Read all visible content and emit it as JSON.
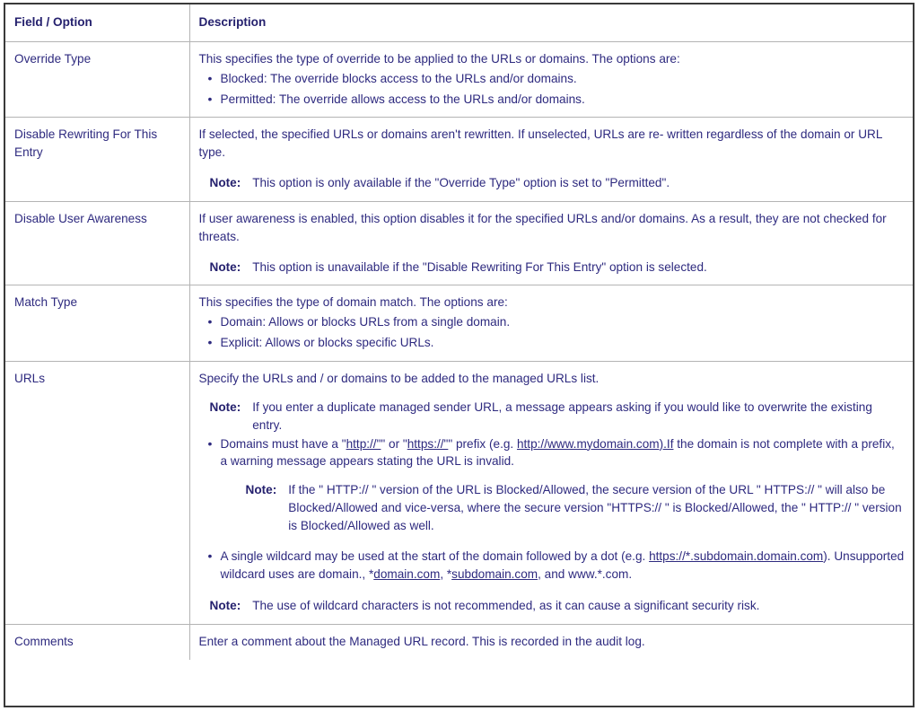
{
  "table": {
    "headers": {
      "field": "Field / Option",
      "description": "Description"
    },
    "note_label": "Note:",
    "rows": [
      {
        "field": "Override Type",
        "intro": "This specifies the type of override to be applied to the URLs or domains. The options are:",
        "bullets": [
          "Blocked: The override blocks access to the URLs and/or domains.",
          "Permitted: The override allows access to the URLs and/or domains."
        ]
      },
      {
        "field": "Disable Rewriting For This Entry",
        "intro": "If selected, the specified URLs or domains aren't rewritten. If unselected, URLs are re- written regardless of the domain or URL type.",
        "note": "This option is only available if the \"Override Type\" option is set to \"Permitted\"."
      },
      {
        "field": "Disable User Awareness",
        "intro": "If user awareness is enabled, this option disables it for the specified URLs and/or domains. As a result, they are not checked for threats.",
        "note": "This option is unavailable if the \"Disable Rewriting For This Entry\" option is selected."
      },
      {
        "field": "Match Type",
        "intro": "This specifies the type of domain match. The options are:",
        "bullets": [
          "Domain: Allows or blocks URLs from a single domain.",
          "Explicit: Allows or blocks specific URLs."
        ]
      },
      {
        "field": "URLs",
        "intro": "Specify the URLs and / or domains to be added to the managed URLs list.",
        "note_top": "If you enter a duplicate managed sender URL, a message appears asking if you would like to overwrite the existing entry.",
        "bullet_prefix_text": "Domains must have a \"",
        "link_http": "http://\"",
        "bullet_mid_or": "\" or \"",
        "link_https": "https://\"",
        "bullet_after_prefix": "\" prefix (e.g. ",
        "link_example": "http://www.mydomain.com).If",
        "bullet_tail": " the domain is not complete with a prefix, a warning message appears stating the URL is invalid.",
        "nested_note": "If the \" HTTP:// \" version of the URL is Blocked/Allowed, the secure version of the URL \" HTTPS:// \" will also be Blocked/Allowed and vice-versa, where the secure version \"HTTPS:// \" is Blocked/Allowed, the \" HTTP:// \" version is Blocked/Allowed as well.",
        "wildcard_prefix": "A single wildcard may be used at the start of the domain followed by a dot (e.g. ",
        "link_wildcard": "https://*.subdomain.domain.com",
        "wildcard_mid": "). Unsupported wildcard uses are domain., *",
        "link_domain": "domain.com",
        "wildcard_mid2": ", *",
        "link_subdomain": "subdomain.com",
        "wildcard_tail": ", and www.*.com.",
        "note_bottom": "The use of wildcard characters is not recommended, as it can cause a significant security risk."
      },
      {
        "field": "Comments",
        "intro": "Enter a comment about the Managed URL record. This is recorded in the audit log."
      }
    ]
  },
  "colors": {
    "text": "#2e2a7f",
    "border": "#b4b4b4",
    "outer_border": "#3a3a3a",
    "background": "#ffffff"
  }
}
